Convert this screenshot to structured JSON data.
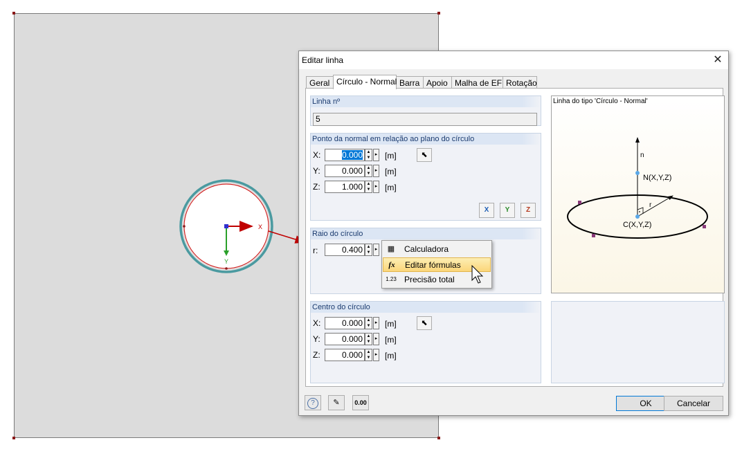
{
  "colors": {
    "accent": "#0078d7",
    "arrow_red": "#c00000",
    "axis_green": "#2aa02a",
    "circle_teal": "#4a9aa0"
  },
  "model": {
    "axis_x_label": "X",
    "axis_y_label": "Y"
  },
  "dialog": {
    "title": "Editar linha",
    "tabs": [
      {
        "label": "Geral",
        "active": false
      },
      {
        "label": "Círculo - Normal",
        "active": true
      },
      {
        "label": "Barra",
        "active": false
      },
      {
        "label": "Apoio",
        "active": false
      },
      {
        "label": "Malha de EF",
        "active": false
      },
      {
        "label": "Rotação",
        "active": false
      }
    ],
    "line_no": {
      "label": "Linha nº",
      "value": "5"
    },
    "normal_point": {
      "title": "Ponto da normal em relação ao plano do círculo",
      "x": {
        "label": "X:",
        "value": "0.000",
        "unit": "[m]"
      },
      "y": {
        "label": "Y:",
        "value": "0.000",
        "unit": "[m]"
      },
      "z": {
        "label": "Z:",
        "value": "1.000",
        "unit": "[m]"
      },
      "tools": [
        "X",
        "Y",
        "Z"
      ]
    },
    "radius": {
      "title": "Raio do círculo",
      "label": "r:",
      "value": "0.400"
    },
    "center": {
      "title": "Centro do círculo",
      "x": {
        "label": "X:",
        "value": "0.000",
        "unit": "[m]"
      },
      "y": {
        "label": "Y:",
        "value": "0.000",
        "unit": "[m]"
      },
      "z": {
        "label": "Z:",
        "value": "0.000",
        "unit": "[m]"
      }
    },
    "context_menu": [
      {
        "label": "Calculadora",
        "icon": "calculator-icon",
        "hover": false
      },
      {
        "label": "Editar fórmulas",
        "icon": "fx-formula-icon",
        "hover": true
      },
      {
        "label": "Precisão total",
        "icon": "precision-icon",
        "hover": false
      }
    ],
    "preview": {
      "title": "Linha do tipo 'Círculo - Normal'",
      "n_label": "n",
      "n_point_label": "N(X,Y,Z)",
      "r_label": "r",
      "c_point_label": "C(X,Y,Z)"
    },
    "footer": {
      "ok": "OK",
      "cancel": "Cancelar",
      "precision_icon_text": "0.00"
    }
  }
}
